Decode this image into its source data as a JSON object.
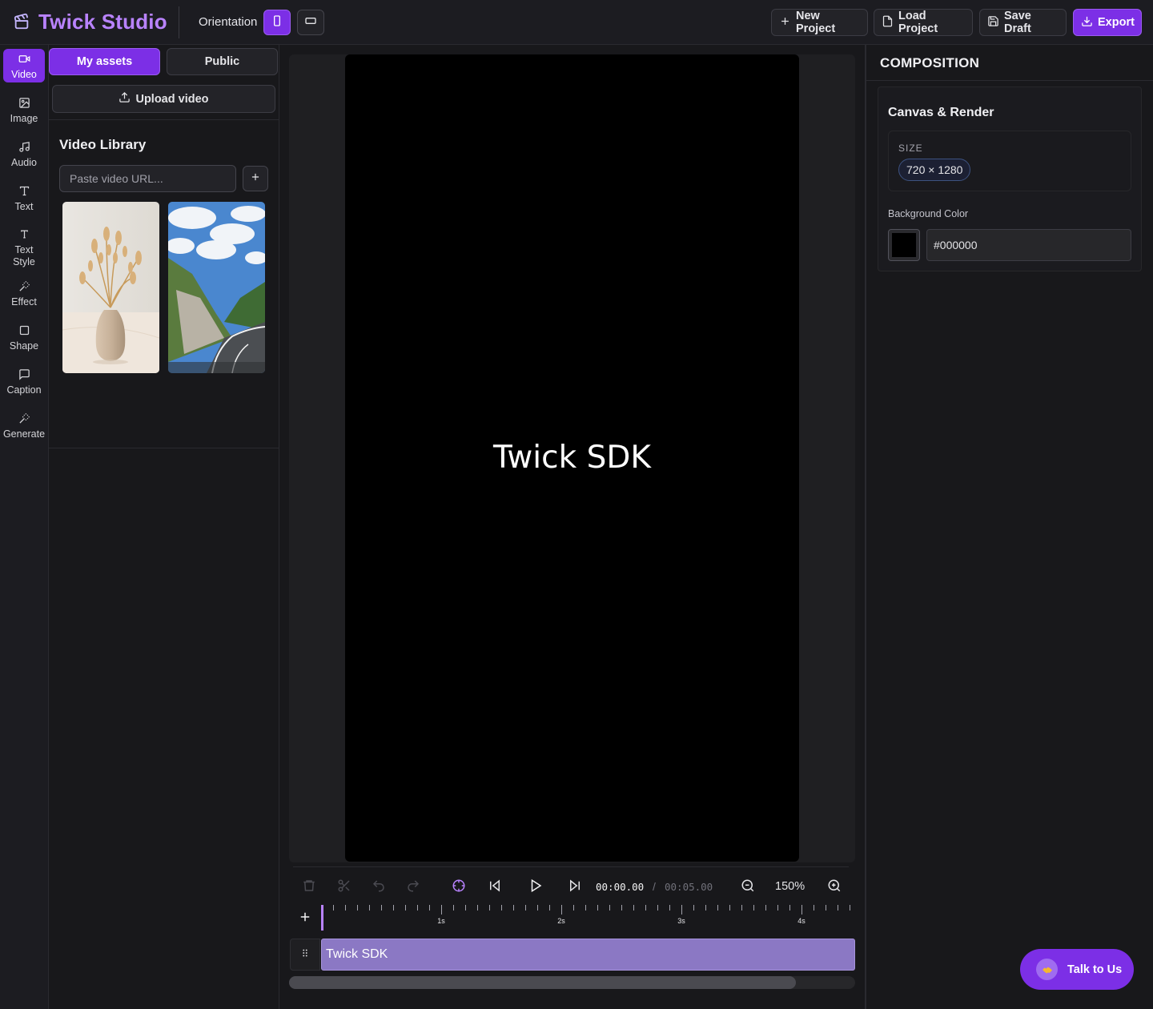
{
  "header": {
    "app_title": "Twick Studio",
    "orientation_label": "Orientation",
    "orientation_selected": "portrait",
    "buttons": {
      "new_project": "New Project",
      "load_project": "Load Project",
      "save_draft": "Save Draft",
      "export": "Export"
    },
    "colors": {
      "accent": "#7c2fe6",
      "title": "#b983ff"
    }
  },
  "sidebar": {
    "items": [
      {
        "label": "Video",
        "icon": "video-icon",
        "active": true
      },
      {
        "label": "Image",
        "icon": "image-icon",
        "active": false
      },
      {
        "label": "Audio",
        "icon": "music-note-icon",
        "active": false
      },
      {
        "label": "Text",
        "icon": "type-icon",
        "active": false
      },
      {
        "label": "Text",
        "label2": "Style",
        "icon": "text-style-icon",
        "active": false
      },
      {
        "label": "Effect",
        "icon": "magic-wand-icon",
        "active": false
      },
      {
        "label": "Shape",
        "icon": "square-icon",
        "active": false
      },
      {
        "label": "Caption",
        "icon": "message-square-icon",
        "active": false
      },
      {
        "label": "Generate",
        "icon": "magic-wand-icon",
        "active": false
      }
    ]
  },
  "assets": {
    "tabs": {
      "mine": "My assets",
      "public": "Public"
    },
    "active_tab": "mine",
    "upload_label": "Upload video",
    "library_title": "Video Library",
    "url_input": {
      "placeholder": "Paste video URL...",
      "value": ""
    },
    "thumbnails": [
      {
        "name": "dried-flowers-vase"
      },
      {
        "name": "mountain-road"
      }
    ]
  },
  "canvas": {
    "text": "Twick SDK",
    "background": "#000000"
  },
  "timeline": {
    "current_time": "00:00.00",
    "separator": "/",
    "total_time": "00:05.00",
    "zoom": "150%",
    "ruler_labels": [
      "1s",
      "2s",
      "3s",
      "4s"
    ],
    "clip_label": "Twick SDK",
    "clip_color": "#8b78c4"
  },
  "properties": {
    "title": "COMPOSITION",
    "section_title": "Canvas & Render",
    "size_label": "SIZE",
    "size_value": "720 × 1280",
    "bg_color_label": "Background Color",
    "bg_color_value": "#000000"
  },
  "chat": {
    "label": "Talk to Us"
  }
}
